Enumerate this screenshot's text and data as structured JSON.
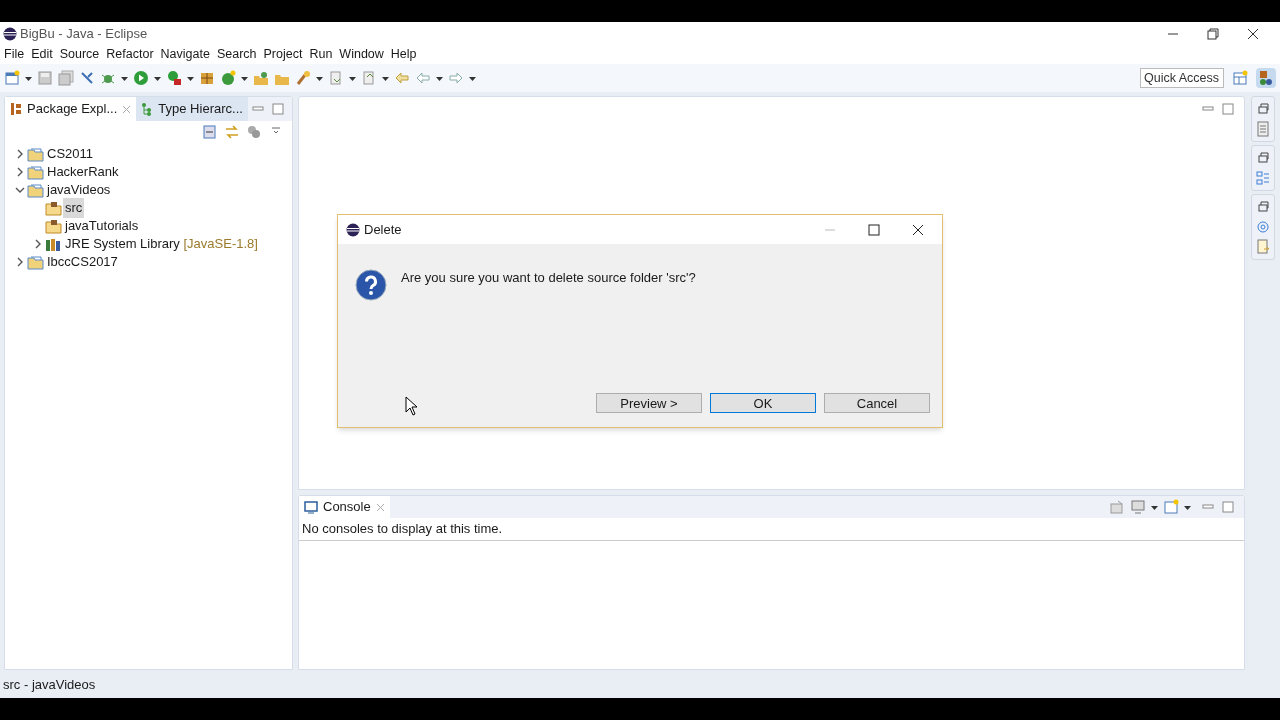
{
  "window": {
    "title": "BigBu - Java - Eclipse"
  },
  "menu": [
    "File",
    "Edit",
    "Source",
    "Refactor",
    "Navigate",
    "Search",
    "Project",
    "Run",
    "Window",
    "Help"
  ],
  "quick_access": {
    "placeholder": "Quick Access"
  },
  "left_tabs": [
    {
      "label": "Package Expl...",
      "selected": true
    },
    {
      "label": "Type Hierarc...",
      "selected": false
    }
  ],
  "tree": [
    {
      "label": "CS2011",
      "kind": "project",
      "expanded": false,
      "selected": false
    },
    {
      "label": "HackerRank",
      "kind": "project",
      "expanded": false,
      "selected": false
    },
    {
      "label": "javaVideos",
      "kind": "project",
      "expanded": true,
      "selected": false,
      "children": [
        {
          "label": "src",
          "kind": "package",
          "selected": true
        },
        {
          "label": "javaTutorials",
          "kind": "package",
          "selected": false
        },
        {
          "label": "JRE System Library",
          "suffix": "[JavaSE-1.8]",
          "kind": "library",
          "expanded": false,
          "selected": false
        }
      ]
    },
    {
      "label": "IbccCS2017",
      "kind": "project",
      "expanded": false,
      "selected": false
    }
  ],
  "dialog": {
    "title": "Delete",
    "message": "Are you sure you want to delete source folder 'src'?",
    "buttons": [
      {
        "label": "Preview >",
        "focused": false
      },
      {
        "label": "OK",
        "focused": true
      },
      {
        "label": "Cancel",
        "focused": false
      }
    ]
  },
  "console": {
    "tab": "Console",
    "message": "No consoles to display at this time."
  },
  "status_bar": "src - javaVideos"
}
